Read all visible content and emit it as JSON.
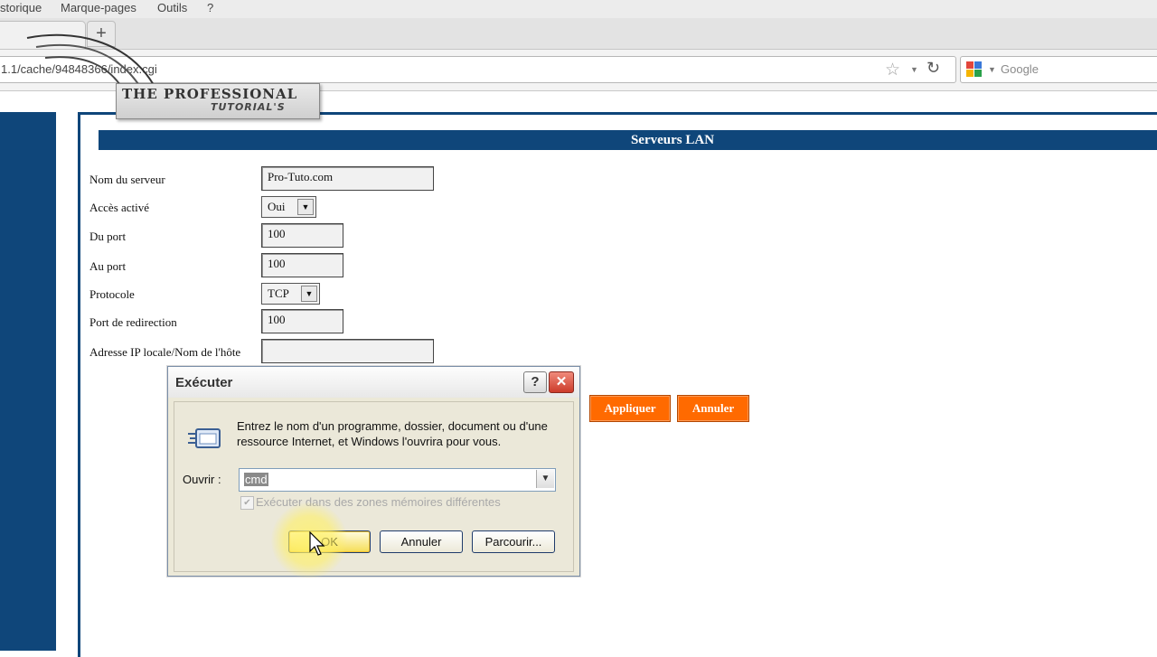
{
  "browser": {
    "menu": [
      "storique",
      "Marque-pages",
      "Outils",
      "?"
    ],
    "url": "1.1/cache/94848366/index.cgi",
    "search_placeholder": "Google",
    "new_tab_symbol": "+"
  },
  "watermark": {
    "line1": "THE PROFESSIONAL",
    "line2": "TUTORIAL'S"
  },
  "page": {
    "section_title": "Serveurs LAN",
    "form": {
      "server_name": {
        "label": "Nom du serveur",
        "value": "Pro-Tuto.com"
      },
      "access": {
        "label": "Accès activé",
        "value": "Oui"
      },
      "from_port": {
        "label": "Du port",
        "value": "100"
      },
      "to_port": {
        "label": "Au port",
        "value": "100"
      },
      "protocol": {
        "label": "Protocole",
        "value": "TCP"
      },
      "redirect_port": {
        "label": "Port de redirection",
        "value": "100"
      },
      "local_ip": {
        "label": "Adresse IP locale/Nom de l'hôte",
        "value": ""
      }
    },
    "apply_label": "Appliquer",
    "cancel_label": "Annuler"
  },
  "run_dialog": {
    "title": "Exécuter",
    "help_symbol": "?",
    "close_symbol": "✕",
    "description": "Entrez le nom d'un programme, dossier, document ou d'une ressource Internet, et Windows l'ouvrira pour vous.",
    "open_label": "Ouvrir :",
    "open_value": "cmd",
    "checkbox_label": "Exécuter dans des zones mémoires différentes",
    "ok_label": "OK",
    "cancel_label": "Annuler",
    "browse_label": "Parcourir..."
  },
  "colors": {
    "nav_blue": "#0f467a",
    "orange": "#ff6a00"
  }
}
